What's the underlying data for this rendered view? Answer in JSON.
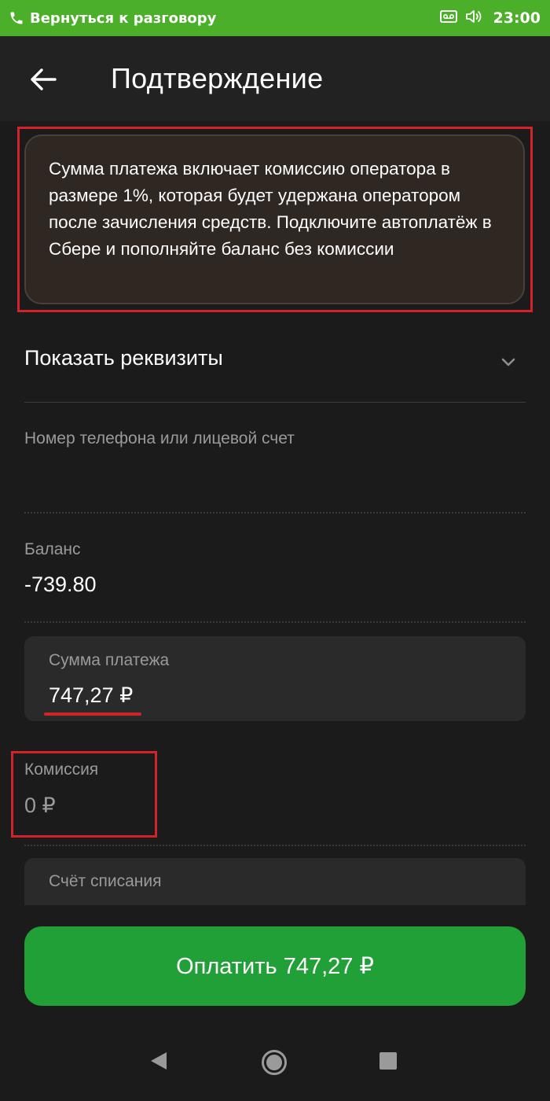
{
  "status_bar": {
    "return_call": "Вернуться к разговору",
    "time": "23:00",
    "icons": [
      "phone-icon",
      "voicemail-icon",
      "volume-icon"
    ]
  },
  "header": {
    "title": "Подтверждение",
    "back_icon": "arrow-left-icon"
  },
  "notice": {
    "text": "Сумма платежа включает комиссию оператора в размере 1%, которая будет удержана оператором после зачисления средств. Подключите автоплатёж в Сбере и пополняйте баланс без комиссии"
  },
  "requisites": {
    "label": "Показать реквизиты",
    "icon": "chevron-down-icon"
  },
  "fields": {
    "phone_label": "Номер телефона или лицевой счет",
    "balance_label": "Баланс",
    "balance_value": "-739.80",
    "amount_label": "Сумма платежа",
    "amount_value": "747,27 ₽",
    "commission_label": "Комиссия",
    "commission_value": "0 ₽",
    "account_label": "Счёт списания"
  },
  "pay_button": {
    "label": "Оплатить 747,27 ₽"
  },
  "nav_bar": {
    "icons": [
      "nav-back-icon",
      "nav-home-icon",
      "nav-recent-icon"
    ]
  },
  "colors": {
    "status_bar": "#4caf2a",
    "background": "#1b1b1b",
    "pay_button": "#21a038",
    "highlight": "#d2232a"
  }
}
